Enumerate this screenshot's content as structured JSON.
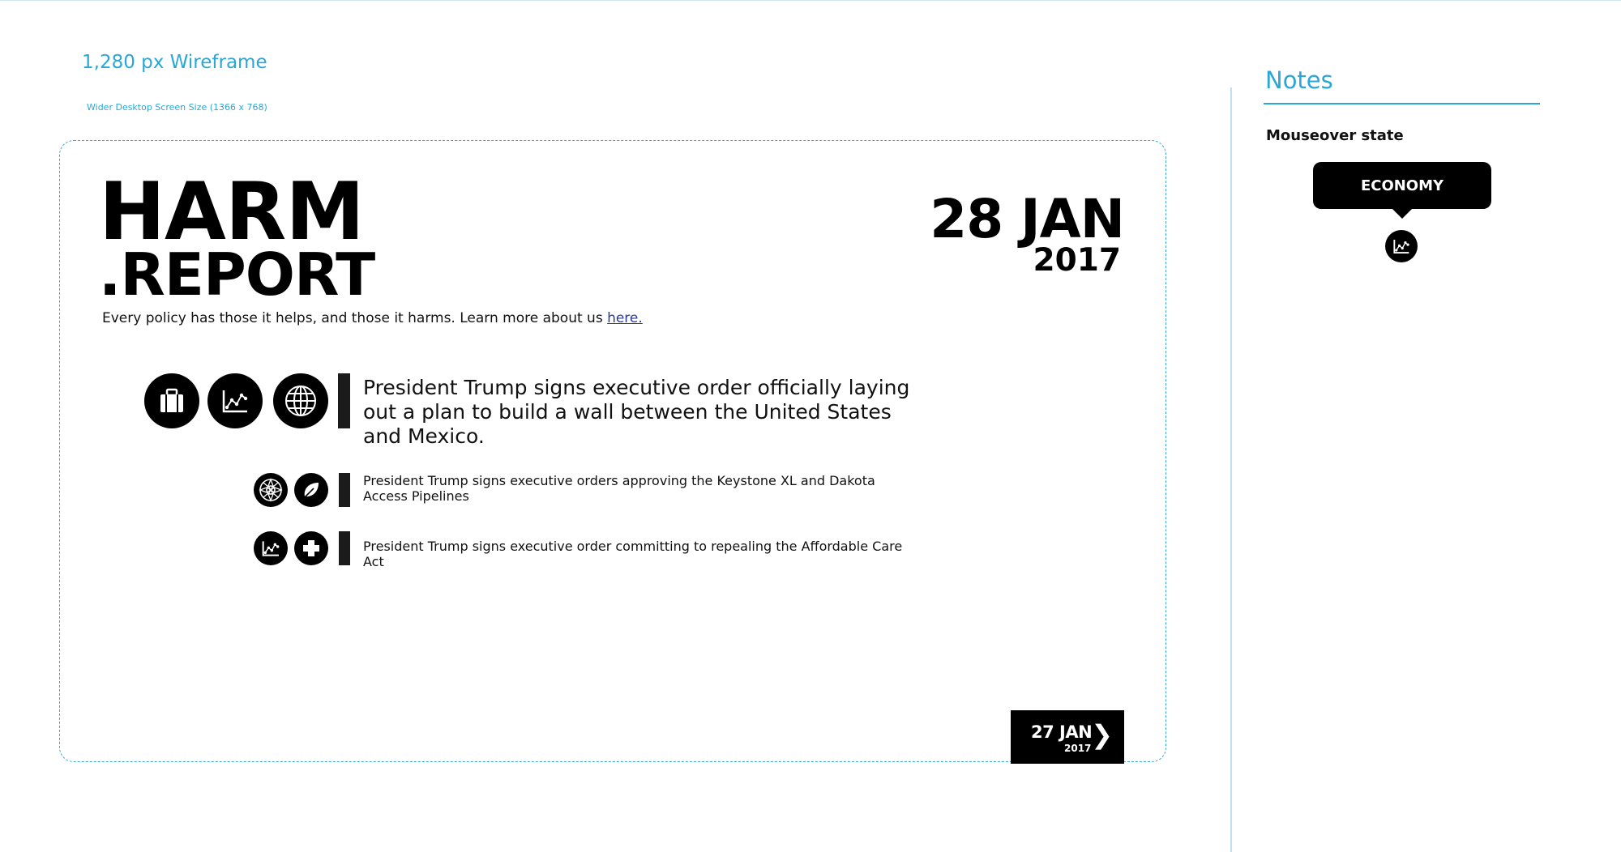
{
  "header": {
    "wireframe_title": "1,280 px Wireframe",
    "wireframe_subtitle": "Wider Desktop Screen Size  (1366 x 768)"
  },
  "site": {
    "logo_line1": "HARM",
    "logo_line2": ".REPORT",
    "tagline_prefix": "Every policy has those it helps, and those it harms. Learn more about us ",
    "tagline_link": "here."
  },
  "current_date": {
    "day_month": "28 JAN",
    "year": "2017"
  },
  "stories": [
    {
      "icons": [
        "briefcase-icon",
        "economy-chart-icon",
        "globe-icon"
      ],
      "text": "President Trump signs executive order officially laying out a plan to build a wall between the United States and Mexico."
    },
    {
      "icons": [
        "mandala-icon",
        "leaf-icon"
      ],
      "text": "President Trump signs executive orders approving the Keystone XL and Dakota Access Pipelines"
    },
    {
      "icons": [
        "economy-chart-icon",
        "medical-cross-icon"
      ],
      "text": "President Trump signs executive order committing to repealing the Affordable Care Act"
    }
  ],
  "prev_date": {
    "day_month": "27 JAN",
    "year": "2017",
    "arrow": "❯"
  },
  "notes": {
    "title": "Notes",
    "label": "Mouseover state",
    "tooltip_text": "ECONOMY",
    "tooltip_icon": "economy-chart-icon"
  },
  "colors": {
    "accent": "#2aa7d6",
    "ink": "#000000",
    "link": "#2b3a9a"
  }
}
